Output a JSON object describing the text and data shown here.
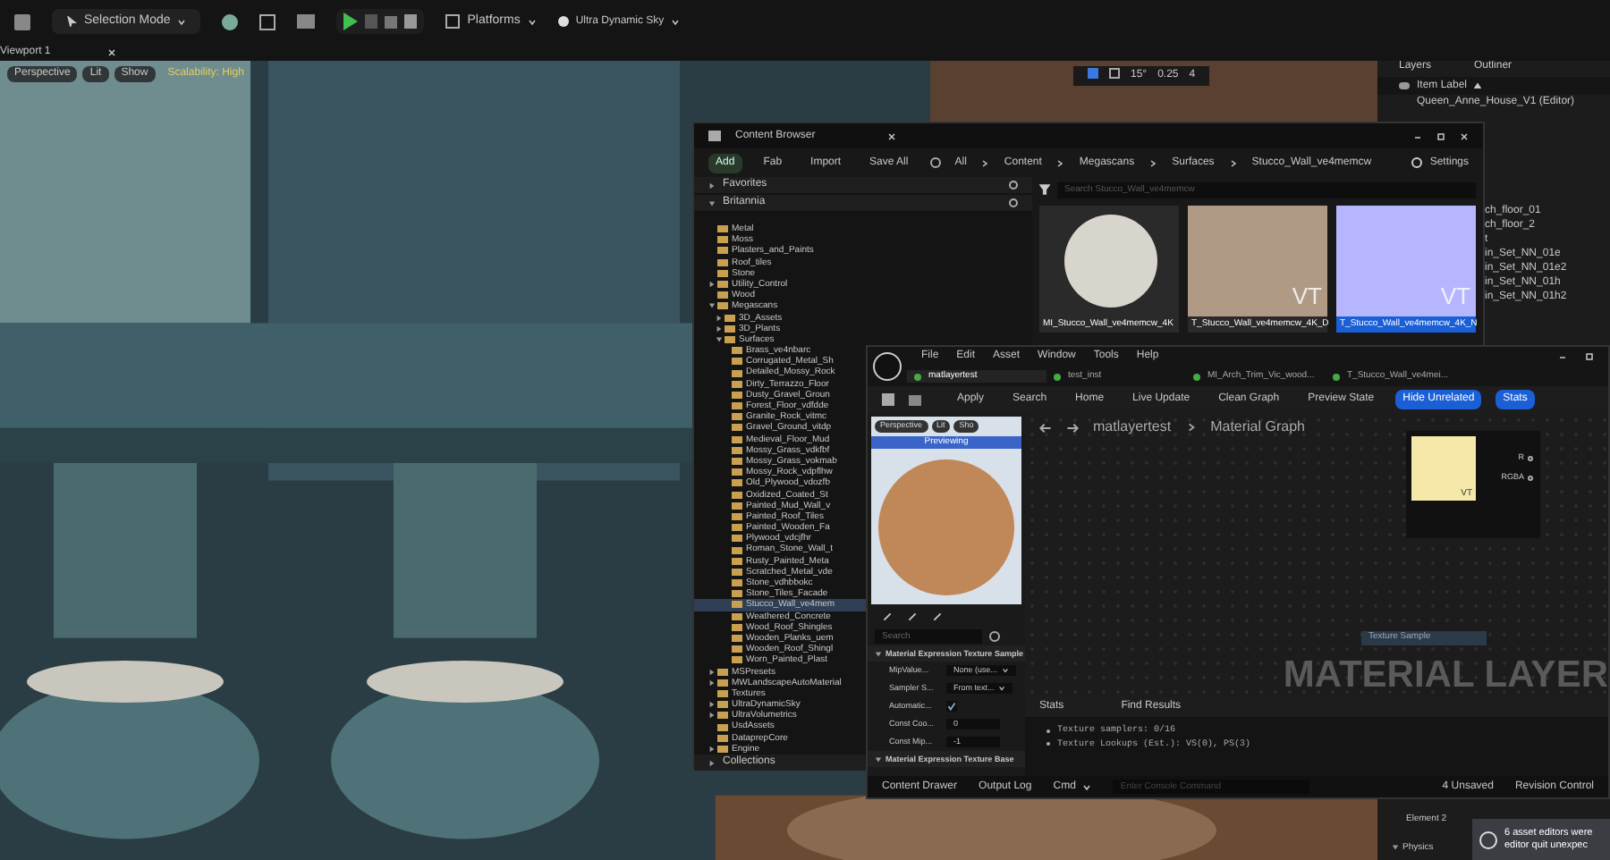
{
  "toolbar": {
    "mode": "Selection Mode",
    "platforms": "Platforms",
    "sky": "Ultra Dynamic Sky"
  },
  "viewport": {
    "tab": "Viewport 1",
    "buttons": [
      "Perspective",
      "Lit",
      "Show"
    ],
    "scalability": "Scalability: High",
    "snaps": [
      "15°",
      "0.25",
      "4"
    ]
  },
  "outliner": {
    "tabs": [
      "Layers",
      "Outliner"
    ],
    "header": "Item Label",
    "root": "Queen_Anne_House_V1 (Editor)",
    "rows": [
      "ch_floor_01",
      "ch_floor_2",
      "t",
      "in_Set_NN_01e",
      "in_Set_NN_01e2",
      "in_Set_NN_01h",
      "in_Set_NN_01h2"
    ]
  },
  "content_browser": {
    "title": "Content Browser",
    "actions": [
      "Add",
      "Fab",
      "Import",
      "Save All"
    ],
    "path": [
      "All",
      "Content",
      "Megascans",
      "Surfaces",
      "Stucco_Wall_ve4memcw"
    ],
    "settings": "Settings",
    "sections": [
      "Favorites",
      "Britannia"
    ],
    "search_placeholder": "Search Stucco_Wall_ve4memcw",
    "tree": [
      {
        "label": "Metal"
      },
      {
        "label": "Moss"
      },
      {
        "label": "Plasters_and_Paints"
      },
      {
        "label": "Roof_tiles"
      },
      {
        "label": "Stone"
      },
      {
        "label": "Utility_Control",
        "expanded": false
      },
      {
        "label": "Wood"
      },
      {
        "label": "Megascans",
        "expanded": true,
        "children": [
          {
            "label": "3D_Assets",
            "expanded": false
          },
          {
            "label": "3D_Plants",
            "expanded": false
          },
          {
            "label": "Surfaces",
            "expanded": true,
            "children": [
              {
                "label": "Brass_ve4nbarc",
                "selected": false
              },
              {
                "label": "Corrugated_Metal_Sh",
                "selected": false
              },
              {
                "label": "Detailed_Mossy_Rock",
                "selected": false
              },
              {
                "label": "Dirty_Terrazzo_Floor",
                "selected": false
              },
              {
                "label": "Dusty_Gravel_Groun",
                "selected": false
              },
              {
                "label": "Forest_Floor_vdfdde",
                "selected": false
              },
              {
                "label": "Granite_Rock_vitmc",
                "selected": false
              },
              {
                "label": "Gravel_Ground_vitdp",
                "selected": false
              },
              {
                "label": "Medieval_Floor_Mud",
                "selected": false
              },
              {
                "label": "Mossy_Grass_vdkfbf",
                "selected": false
              },
              {
                "label": "Mossy_Grass_vokmab",
                "selected": false
              },
              {
                "label": "Mossy_Rock_vdpflhw",
                "selected": false
              },
              {
                "label": "Old_Plywood_vdozfb",
                "selected": false
              },
              {
                "label": "Oxidized_Coated_St",
                "selected": false
              },
              {
                "label": "Painted_Mud_Wall_v",
                "selected": false
              },
              {
                "label": "Painted_Roof_Tiles",
                "selected": false
              },
              {
                "label": "Painted_Wooden_Fa",
                "selected": false
              },
              {
                "label": "Plywood_vdcjfhr",
                "selected": false
              },
              {
                "label": "Roman_Stone_Wall_t",
                "selected": false
              },
              {
                "label": "Rusty_Painted_Meta",
                "selected": false
              },
              {
                "label": "Scratched_Metal_vde",
                "selected": false
              },
              {
                "label": "Stone_vdhbbokc",
                "selected": false
              },
              {
                "label": "Stone_Tiles_Facade",
                "selected": false
              },
              {
                "label": "Stucco_Wall_ve4mem",
                "selected": true
              },
              {
                "label": "Weathered_Concrete",
                "selected": false
              },
              {
                "label": "Wood_Roof_Shingles",
                "selected": false
              },
              {
                "label": "Wooden_Planks_uem",
                "selected": false
              },
              {
                "label": "Wooden_Roof_Shingl",
                "selected": false
              },
              {
                "label": "Worn_Painted_Plast",
                "selected": false
              }
            ]
          }
        ]
      },
      {
        "label": "MSPresets",
        "expanded": false
      },
      {
        "label": "MWLandscapeAutoMaterial",
        "expanded": false
      },
      {
        "label": "Textures"
      },
      {
        "label": "UltraDynamicSky",
        "expanded": false
      },
      {
        "label": "UltraVolumetrics",
        "expanded": false
      },
      {
        "label": "UsdAssets"
      },
      {
        "label": "DataprepCore"
      },
      {
        "label": "Engine",
        "expanded": false
      }
    ],
    "collections": "Collections",
    "assets": [
      {
        "name": "MI_Stucco_Wall_ve4memcw_4K",
        "kind": "sphere",
        "selected": false
      },
      {
        "name": "T_Stucco_Wall_ve4memcw_4K_D",
        "kind": "diffuse",
        "badge": "VT",
        "selected": false
      },
      {
        "name": "T_Stucco_Wall_ve4memcw_4K_N",
        "kind": "normal",
        "badge": "VT",
        "selected": true
      }
    ]
  },
  "material_editor": {
    "menu": [
      "File",
      "Edit",
      "Asset",
      "Window",
      "Tools",
      "Help"
    ],
    "tabs": [
      {
        "label": "matlayertest",
        "selected": true
      },
      {
        "label": "test_inst",
        "selected": false
      },
      {
        "label": "MI_Arch_Trim_Vic_wood...",
        "selected": false
      },
      {
        "label": "T_Stucco_Wall_ve4mei...",
        "selected": false
      }
    ],
    "tools": [
      {
        "label": "Apply",
        "on": false
      },
      {
        "label": "Search",
        "on": false
      },
      {
        "label": "Home",
        "on": false
      },
      {
        "label": "Live Update",
        "on": false
      },
      {
        "label": "Clean Graph",
        "on": false
      },
      {
        "label": "Preview State",
        "on": false
      },
      {
        "label": "Hide Unrelated",
        "on": true
      },
      {
        "label": "Stats",
        "on": true
      }
    ],
    "preview_buttons": [
      "Perspective",
      "Lit",
      "Sho"
    ],
    "preview_banner": "Previewing",
    "details_placeholder": "Search",
    "details": [
      {
        "section": "Material Expression Texture Sample",
        "rows": [
          {
            "label": "MipValue...",
            "kind": "dropdown",
            "value": "None (use..."
          },
          {
            "label": "Sampler S...",
            "kind": "dropdown",
            "value": "From text..."
          },
          {
            "label": "Automatic...",
            "kind": "checkbox",
            "checked": true
          },
          {
            "label": "Const Coo...",
            "kind": "number",
            "value": "0"
          },
          {
            "label": "Const Mip...",
            "kind": "number",
            "value": "-1"
          }
        ]
      },
      {
        "section": "Material Expression Texture Base"
      }
    ],
    "breadcrumb": [
      "matlayertest",
      "Material Graph"
    ],
    "node_preview": {
      "badge": "VT",
      "pins": [
        "R",
        "RGBA"
      ]
    },
    "node": "Texture Sample",
    "watermark": "MATERIAL LAYER",
    "stats_tabs": [
      "Stats",
      "Find Results"
    ],
    "stats": [
      "Texture samplers: 0/16",
      "Texture Lookups (Est.): VS(0), PS(3)"
    ],
    "status": {
      "drawer": "Content Drawer",
      "log": "Output Log",
      "cmd": "Cmd",
      "console_placeholder": "Enter Console Command",
      "unsaved": "4 Unsaved",
      "revision": "Revision Control"
    }
  },
  "details": {
    "row": "Element 2",
    "section": "Physics"
  },
  "notification": "6 asset editors were editor quit unexpec"
}
